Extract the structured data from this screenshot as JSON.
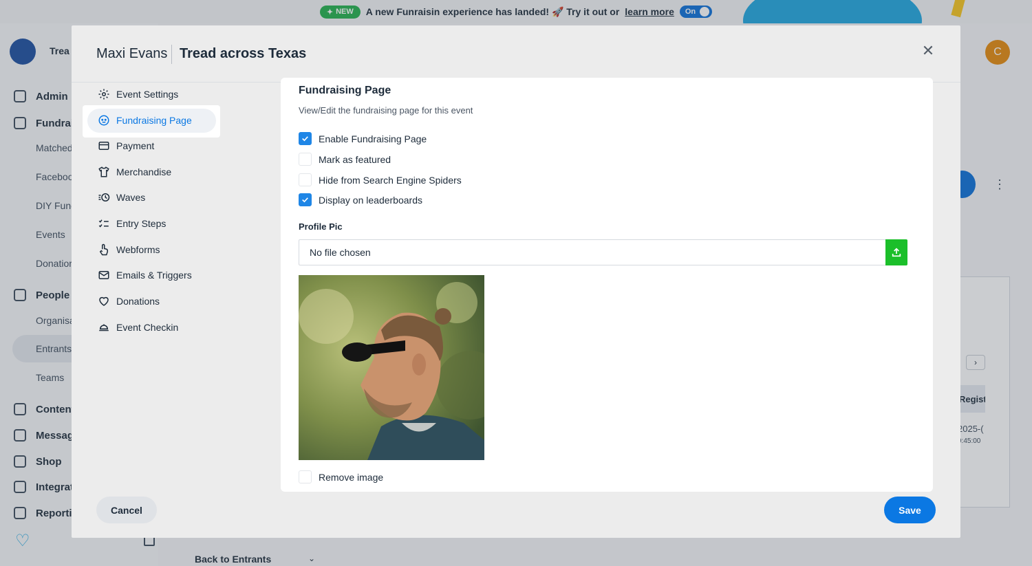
{
  "banner": {
    "badge": "NEW",
    "message": "A new Funraisin experience has landed! 🚀 Try it out or",
    "link": "learn more",
    "toggle": "On"
  },
  "background": {
    "app_title": "Trea",
    "avatar_initial": "C",
    "nav": [
      {
        "label": "Admin",
        "bold": true
      },
      {
        "label": "Fundrai",
        "bold": true
      },
      {
        "label": "Matched",
        "bold": false
      },
      {
        "label": "Faceboo",
        "bold": false
      },
      {
        "label": "DIY Func",
        "bold": false
      },
      {
        "label": "Events",
        "bold": false
      },
      {
        "label": "Donatior",
        "bold": false
      },
      {
        "label": "People",
        "bold": true
      },
      {
        "label": "Organisa",
        "bold": false
      },
      {
        "label": "Entrants",
        "bold": false
      },
      {
        "label": "Teams",
        "bold": false
      },
      {
        "label": "Content",
        "bold": true
      },
      {
        "label": "Messag",
        "bold": true
      },
      {
        "label": "Shop",
        "bold": true
      },
      {
        "label": "Integrat",
        "bold": true
      },
      {
        "label": "Reporti",
        "bold": true
      }
    ],
    "table_header": "Regist",
    "table_date": "2025-(",
    "table_time": "9:45:00",
    "back_link": "Back to Entrants"
  },
  "modal": {
    "user_name": "Maxi Evans",
    "event_name": "Tread across Texas",
    "nav": [
      {
        "label": "Event Settings",
        "icon": "gear-icon"
      },
      {
        "label": "Fundraising Page",
        "icon": "face-icon",
        "active": true
      },
      {
        "label": "Payment",
        "icon": "credit-card-icon"
      },
      {
        "label": "Merchandise",
        "icon": "shirt-icon"
      },
      {
        "label": "Waves",
        "icon": "clock-list-icon"
      },
      {
        "label": "Entry Steps",
        "icon": "checklist-icon"
      },
      {
        "label": "Webforms",
        "icon": "pointer-hand-icon"
      },
      {
        "label": "Emails & Triggers",
        "icon": "envelope-icon"
      },
      {
        "label": "Donations",
        "icon": "heart-icon"
      },
      {
        "label": "Event Checkin",
        "icon": "checkin-icon"
      }
    ],
    "section_title": "Fundraising Page",
    "section_subtitle": "View/Edit the fundraising page for this event",
    "checkboxes": [
      {
        "label": "Enable Fundraising Page",
        "checked": true
      },
      {
        "label": "Mark as featured",
        "checked": false
      },
      {
        "label": "Hide from Search Engine Spiders",
        "checked": false
      },
      {
        "label": "Display on leaderboards",
        "checked": true
      }
    ],
    "profile_pic_label": "Profile Pic",
    "file_value": "No file chosen",
    "remove_image_label": "Remove image",
    "cancel_label": "Cancel",
    "save_label": "Save"
  },
  "colors": {
    "accent": "#0b78e3",
    "checkbox": "#1f86e6",
    "upload": "#1bbf2a",
    "new_badge": "#22b14c"
  }
}
